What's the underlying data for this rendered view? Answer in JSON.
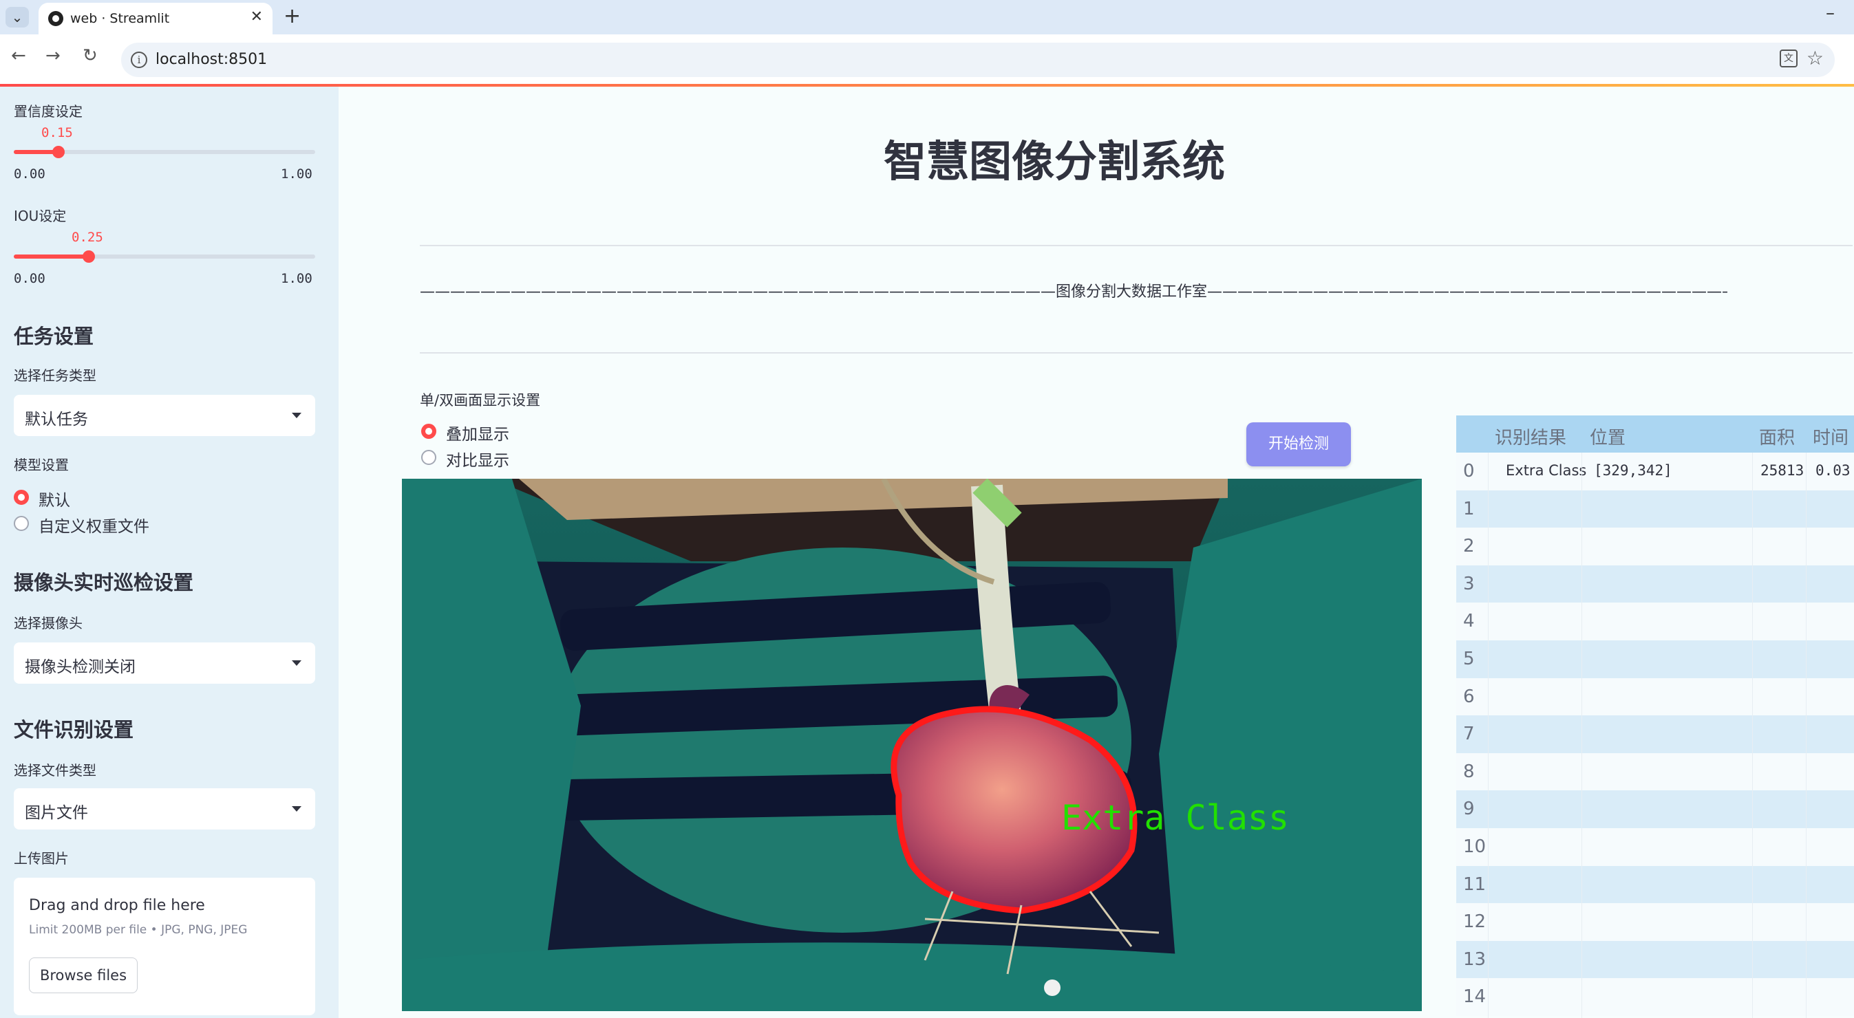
{
  "browser": {
    "tab_title": "web · Streamlit",
    "url": "localhost:8501"
  },
  "sidebar": {
    "confidence": {
      "label": "置信度设定",
      "value_text": "0.15",
      "value": 0.15,
      "min": "0.00",
      "max": "1.00"
    },
    "iou": {
      "label": "IOU设定",
      "value_text": "0.25",
      "value": 0.25,
      "min": "0.00",
      "max": "1.00"
    },
    "task_header": "任务设置",
    "task_type_label": "选择任务类型",
    "task_type_value": "默认任务",
    "model_label": "模型设置",
    "model_options": [
      "默认",
      "自定义权重文件"
    ],
    "camera_header": "摄像头实时巡检设置",
    "camera_label": "选择摄像头",
    "camera_value": "摄像头检测关闭",
    "file_header": "文件识别设置",
    "file_type_label": "选择文件类型",
    "file_type_value": "图片文件",
    "upload_label": "上传图片",
    "uploader": {
      "drag_text": "Drag and drop file here",
      "limit_text": "Limit 200MB per file • JPG, PNG, JPEG",
      "browse_label": "Browse files"
    }
  },
  "main": {
    "title": "智慧图像分割系统",
    "subtitle": "——————————————————————————————————————————图像分割大数据工作室——————————————————————————————————————————",
    "display_label": "单/双画面显示设置",
    "display_options": [
      "叠加显示",
      "对比显示"
    ],
    "start_button": "开始检测",
    "detection_label": "Extra Class"
  },
  "table": {
    "headers": [
      "识别结果",
      "位置",
      "面积",
      "时间"
    ],
    "rows": [
      {
        "index": "0",
        "result": "Extra Class",
        "position": "[329,342]",
        "area": "25813",
        "time": "0.03"
      },
      {
        "index": "1"
      },
      {
        "index": "2"
      },
      {
        "index": "3"
      },
      {
        "index": "4"
      },
      {
        "index": "5"
      },
      {
        "index": "6"
      },
      {
        "index": "7"
      },
      {
        "index": "8"
      },
      {
        "index": "9"
      },
      {
        "index": "10"
      },
      {
        "index": "11"
      },
      {
        "index": "12"
      },
      {
        "index": "13"
      },
      {
        "index": "14"
      }
    ]
  },
  "colors": {
    "accent": "#ff4b4b",
    "button": "#8c8ff0",
    "sidebar_bg": "#e4f1f8",
    "table_header": "#abd6f2",
    "detection_outline": "#ff1a1a",
    "detection_text": "#22e000"
  }
}
